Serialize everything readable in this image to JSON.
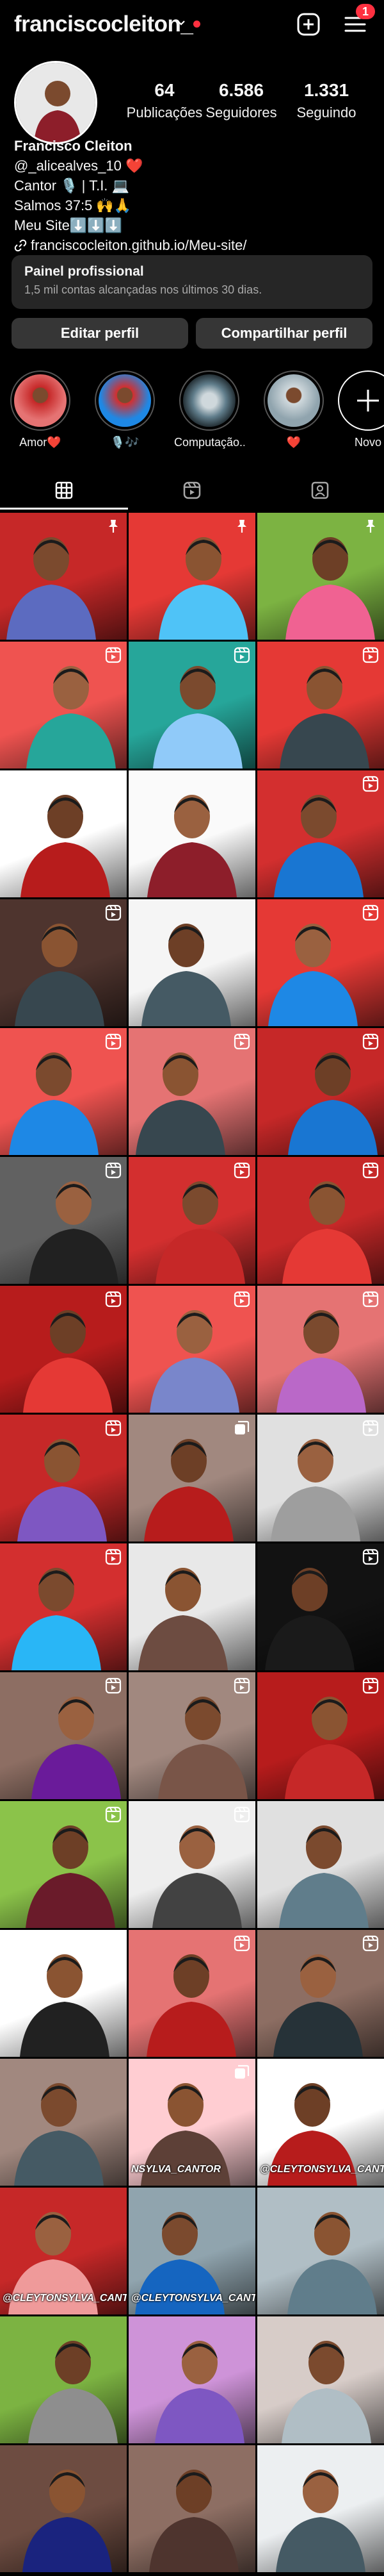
{
  "header": {
    "username": "franciscocleiton_",
    "notifications_count": "1",
    "icons": [
      "chevron-down-icon",
      "create-plus-icon",
      "menu-icon"
    ]
  },
  "profile": {
    "stats": [
      {
        "value": "64",
        "label": "Publicações"
      },
      {
        "value": "6.586",
        "label": "Seguidores"
      },
      {
        "value": "1.331",
        "label": "Seguindo"
      }
    ],
    "name": "Francisco Cleiton",
    "bio_lines": [
      "@_alicealves_10 ❤️",
      "Cantor 🎙️ | T.I. 💻",
      "Salmos 37:5 🙌🙏",
      "Meu Site⬇️⬇️⬇️"
    ],
    "link": "franciscocleiton.github.io/Meu-site/"
  },
  "professional_panel": {
    "title": "Painel profissional",
    "subtitle": "1,5 mil contas alcançadas nos últimos 30 dias."
  },
  "buttons": {
    "edit": "Editar perfil",
    "share": "Compartilhar perfil"
  },
  "highlights": [
    {
      "label": "Amor❤️"
    },
    {
      "label": "🎙️🎶"
    },
    {
      "label": "Computação..."
    },
    {
      "label": "❤️"
    },
    {
      "label": "Novo"
    }
  ],
  "tabs": [
    "grid-icon",
    "reels-icon",
    "tagged-icon"
  ],
  "colors": {
    "background": "#000000",
    "accent_red": "#ff3040",
    "panel": "#262626",
    "button": "#363636"
  },
  "posts": [
    {
      "bg": "#c62828",
      "shirt": "#5c6bc0",
      "badge": "pin"
    },
    {
      "bg": "#e53935",
      "shirt": "#4fc3f7",
      "badge": "pin"
    },
    {
      "bg": "#7cb342",
      "shirt": "#f06292",
      "badge": "pin"
    },
    {
      "bg": "#ef5350",
      "shirt": "#26a69a",
      "badge": "reel"
    },
    {
      "bg": "#26a69a",
      "shirt": "#90caf9",
      "badge": "reel"
    },
    {
      "bg": "#e53935",
      "shirt": "#37474f",
      "badge": "reel"
    },
    {
      "bg": "#ffffff",
      "shirt": "#b71c1c",
      "badge": "none"
    },
    {
      "bg": "#fafafa",
      "shirt": "#8d1e2a",
      "badge": "none"
    },
    {
      "bg": "#d32f2f",
      "shirt": "#1976d2",
      "badge": "reel"
    },
    {
      "bg": "#4e342e",
      "shirt": "#37474f",
      "badge": "reel"
    },
    {
      "bg": "#f5f5f5",
      "shirt": "#455a64",
      "badge": "none"
    },
    {
      "bg": "#e53935",
      "shirt": "#1e88e5",
      "badge": "reel"
    },
    {
      "bg": "#ef5350",
      "shirt": "#1e88e5",
      "badge": "reel"
    },
    {
      "bg": "#e57373",
      "shirt": "#37474f",
      "badge": "reel"
    },
    {
      "bg": "#c62828",
      "shirt": "#1976d2",
      "badge": "reel"
    },
    {
      "bg": "#616161",
      "shirt": "#212121",
      "badge": "reel"
    },
    {
      "bg": "#d32f2f",
      "shirt": "#c62828",
      "badge": "reel"
    },
    {
      "bg": "#c62828",
      "shirt": "#e53935",
      "badge": "reel"
    },
    {
      "bg": "#b71c1c",
      "shirt": "#e53935",
      "badge": "reel"
    },
    {
      "bg": "#ef5350",
      "shirt": "#7986cb",
      "badge": "reel"
    },
    {
      "bg": "#e57373",
      "shirt": "#ba68c8",
      "badge": "reel"
    },
    {
      "bg": "#c62828",
      "shirt": "#7e57c2",
      "badge": "reel"
    },
    {
      "bg": "#a1887f",
      "shirt": "#b71c1c",
      "badge": "multi"
    },
    {
      "bg": "#e0e0e0",
      "shirt": "#9e9e9e",
      "badge": "reel"
    },
    {
      "bg": "#d32f2f",
      "shirt": "#29b6f6",
      "badge": "reel"
    },
    {
      "bg": "#e8e8e8",
      "shirt": "#6d4c41",
      "badge": "none"
    },
    {
      "bg": "#121212",
      "shirt": "#1a1a1a",
      "badge": "reel"
    },
    {
      "bg": "#8d6e63",
      "shirt": "#6a1b9a",
      "badge": "reel"
    },
    {
      "bg": "#a1887f",
      "shirt": "#795548",
      "badge": "reel"
    },
    {
      "bg": "#b71c1c",
      "shirt": "#c62828",
      "badge": "reel"
    },
    {
      "bg": "#8bc34a",
      "shirt": "#6a1b2a",
      "badge": "reel"
    },
    {
      "bg": "#eeeeee",
      "shirt": "#424242",
      "badge": "reel"
    },
    {
      "bg": "#e0e0e0",
      "shirt": "#607d8b",
      "badge": "none"
    },
    {
      "bg": "#ffffff",
      "shirt": "#212121",
      "badge": "none"
    },
    {
      "bg": "#e57373",
      "shirt": "#b71c1c",
      "badge": "reel"
    },
    {
      "bg": "#8d6e63",
      "shirt": "#263238",
      "badge": "reel"
    },
    {
      "bg": "#a1887f",
      "shirt": "#455a64",
      "badge": "none"
    },
    {
      "bg": "#ffcdd2",
      "shirt": "#5d4037",
      "badge": "multi"
    },
    {
      "bg": "#ffffff",
      "shirt": "#b71c1c",
      "badge": "none"
    },
    {
      "bg": "#c62828",
      "shirt": "#ef9a9a",
      "badge": "none"
    },
    {
      "bg": "#90a4ae",
      "shirt": "#1565c0",
      "badge": "none"
    },
    {
      "bg": "#b0bec5",
      "shirt": "#607d8b",
      "badge": "none"
    },
    {
      "bg": "#7cb342",
      "shirt": "#8e8e8e",
      "badge": "none"
    },
    {
      "bg": "#ce93d8",
      "shirt": "#7e57c2",
      "badge": "none"
    },
    {
      "bg": "#d7ccc8",
      "shirt": "#b0bec5",
      "badge": "none"
    },
    {
      "bg": "#6d4c41",
      "shirt": "#1a237e",
      "badge": "none"
    },
    {
      "bg": "#8d6e63",
      "shirt": "#4e342e",
      "badge": "none"
    },
    {
      "bg": "#eceff1",
      "shirt": "#455a64",
      "badge": "none"
    }
  ],
  "post_captions": {
    "37": "NSYLVA_CANTOR",
    "38": "@CLEYTONSYLVA_CANTOR",
    "39": "@CLEYTONSYLVA_CANTOR",
    "40": "@CLEYTONSYLVA_CANTOR"
  }
}
